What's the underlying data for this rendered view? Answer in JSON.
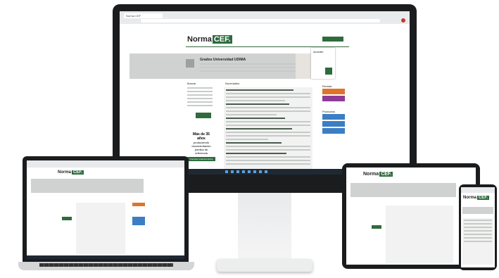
{
  "brand": {
    "name": "Norma",
    "badge": "CEF."
  },
  "browser": {
    "tab_label": "Norma CEF"
  },
  "hero": {
    "title": "Grados Universidad UDIMA"
  },
  "sidebar": {
    "title": "Buscar",
    "search_button": "Buscar"
  },
  "main": {
    "title": "Novedades"
  },
  "promo": {
    "line1": "Más de 35",
    "line2": "años",
    "line3": "produciendo",
    "line4": "documentación",
    "line5": "jurídica de",
    "line6": "referencia",
    "cta": "Comprar producto ahora"
  },
  "right": {
    "label1": "Acceder",
    "label2": "Revista",
    "label3": "Productos"
  },
  "colors": {
    "green": "#2f6b3d",
    "orange": "#e0732c",
    "purple": "#8e3b97",
    "blue": "#3b7ec3"
  }
}
